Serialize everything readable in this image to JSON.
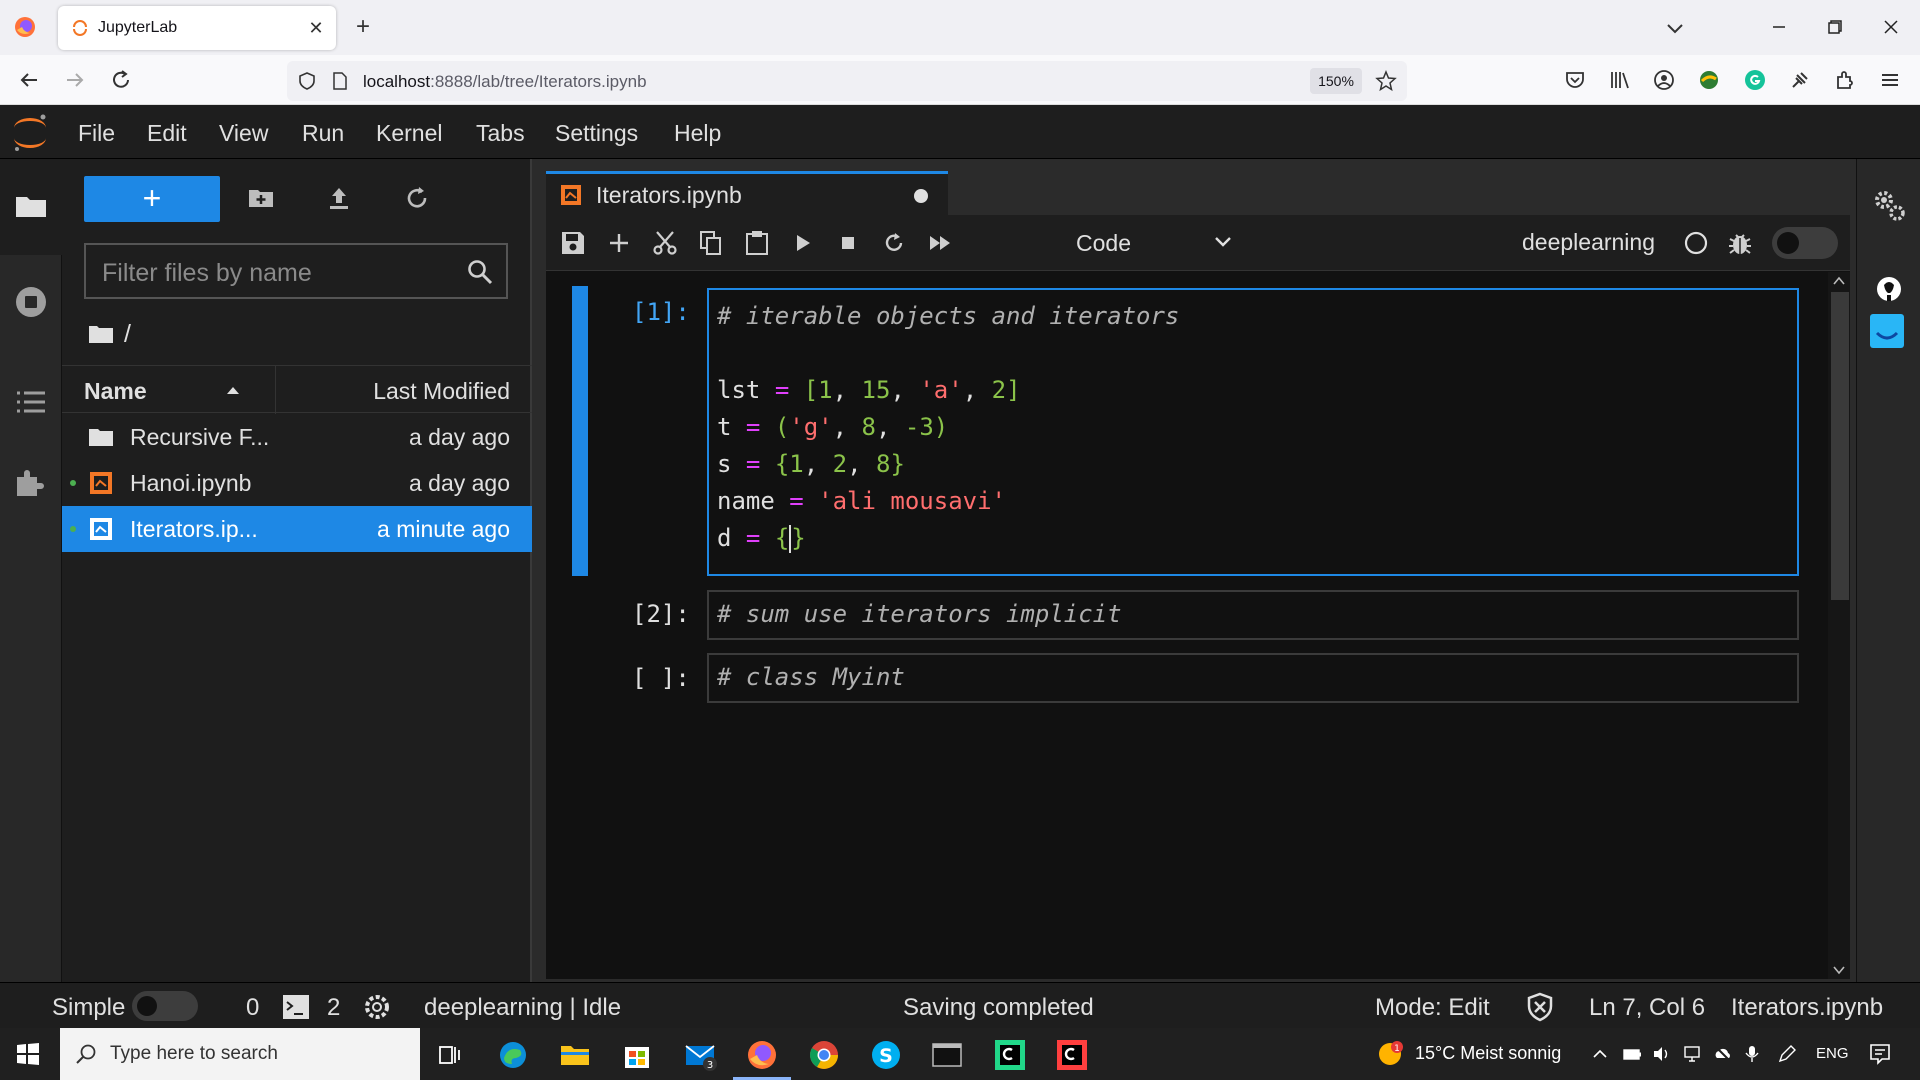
{
  "browser": {
    "tab_title": "JupyterLab",
    "url_host": "localhost",
    "url_rest": ":8888/lab/tree/Iterators.ipynb",
    "zoom": "150%"
  },
  "menubar": {
    "items": [
      "File",
      "Edit",
      "View",
      "Run",
      "Kernel",
      "Tabs",
      "Settings",
      "Help"
    ]
  },
  "filebrowser": {
    "new_label": "+",
    "filter_placeholder": "Filter files by name",
    "breadcrumb": "/",
    "col_name": "Name",
    "col_modified": "Last Modified",
    "files": [
      {
        "name": "Recursive F...",
        "modified": "a day ago",
        "type": "folder"
      },
      {
        "name": "Hanoi.ipynb",
        "modified": "a day ago",
        "type": "notebook",
        "running": true
      },
      {
        "name": "Iterators.ip...",
        "modified": "a minute ago",
        "type": "notebook",
        "running": true,
        "selected": true
      }
    ]
  },
  "notebook": {
    "tab_title": "Iterators.ipynb",
    "cell_type": "Code",
    "kernel": "deeplearning",
    "cells": [
      {
        "prompt": "[1]:",
        "active": true,
        "lines": [
          "# iterable objects and iterators",
          "",
          "lst = [1, 15, 'a', 2]",
          "t = ('g', 8, -3)",
          "s = {1, 2, 8}",
          "name = 'ali mousavi'",
          "d = {}"
        ]
      },
      {
        "prompt": "[2]:",
        "active": false,
        "lines": [
          "# sum use iterators implicit"
        ]
      },
      {
        "prompt": "[ ]:",
        "active": false,
        "lines": [
          "# class Myint"
        ]
      }
    ]
  },
  "statusbar": {
    "simple": "Simple",
    "terminals": "0",
    "kernels": "2",
    "kernel_status": "deeplearning | Idle",
    "save_status": "Saving completed",
    "mode": "Mode: Edit",
    "position": "Ln 7, Col 6",
    "filename": "Iterators.ipynb"
  },
  "taskbar": {
    "search_placeholder": "Type here to search",
    "weather": "15°C  Meist sonnig",
    "language": "ENG",
    "mail_badge": "3"
  },
  "colors": {
    "accent": "#1e88e5",
    "comment": "#b0b0b0",
    "operator": "#e040fb",
    "number": "#8bc34a",
    "string": "#ff6e6e"
  }
}
